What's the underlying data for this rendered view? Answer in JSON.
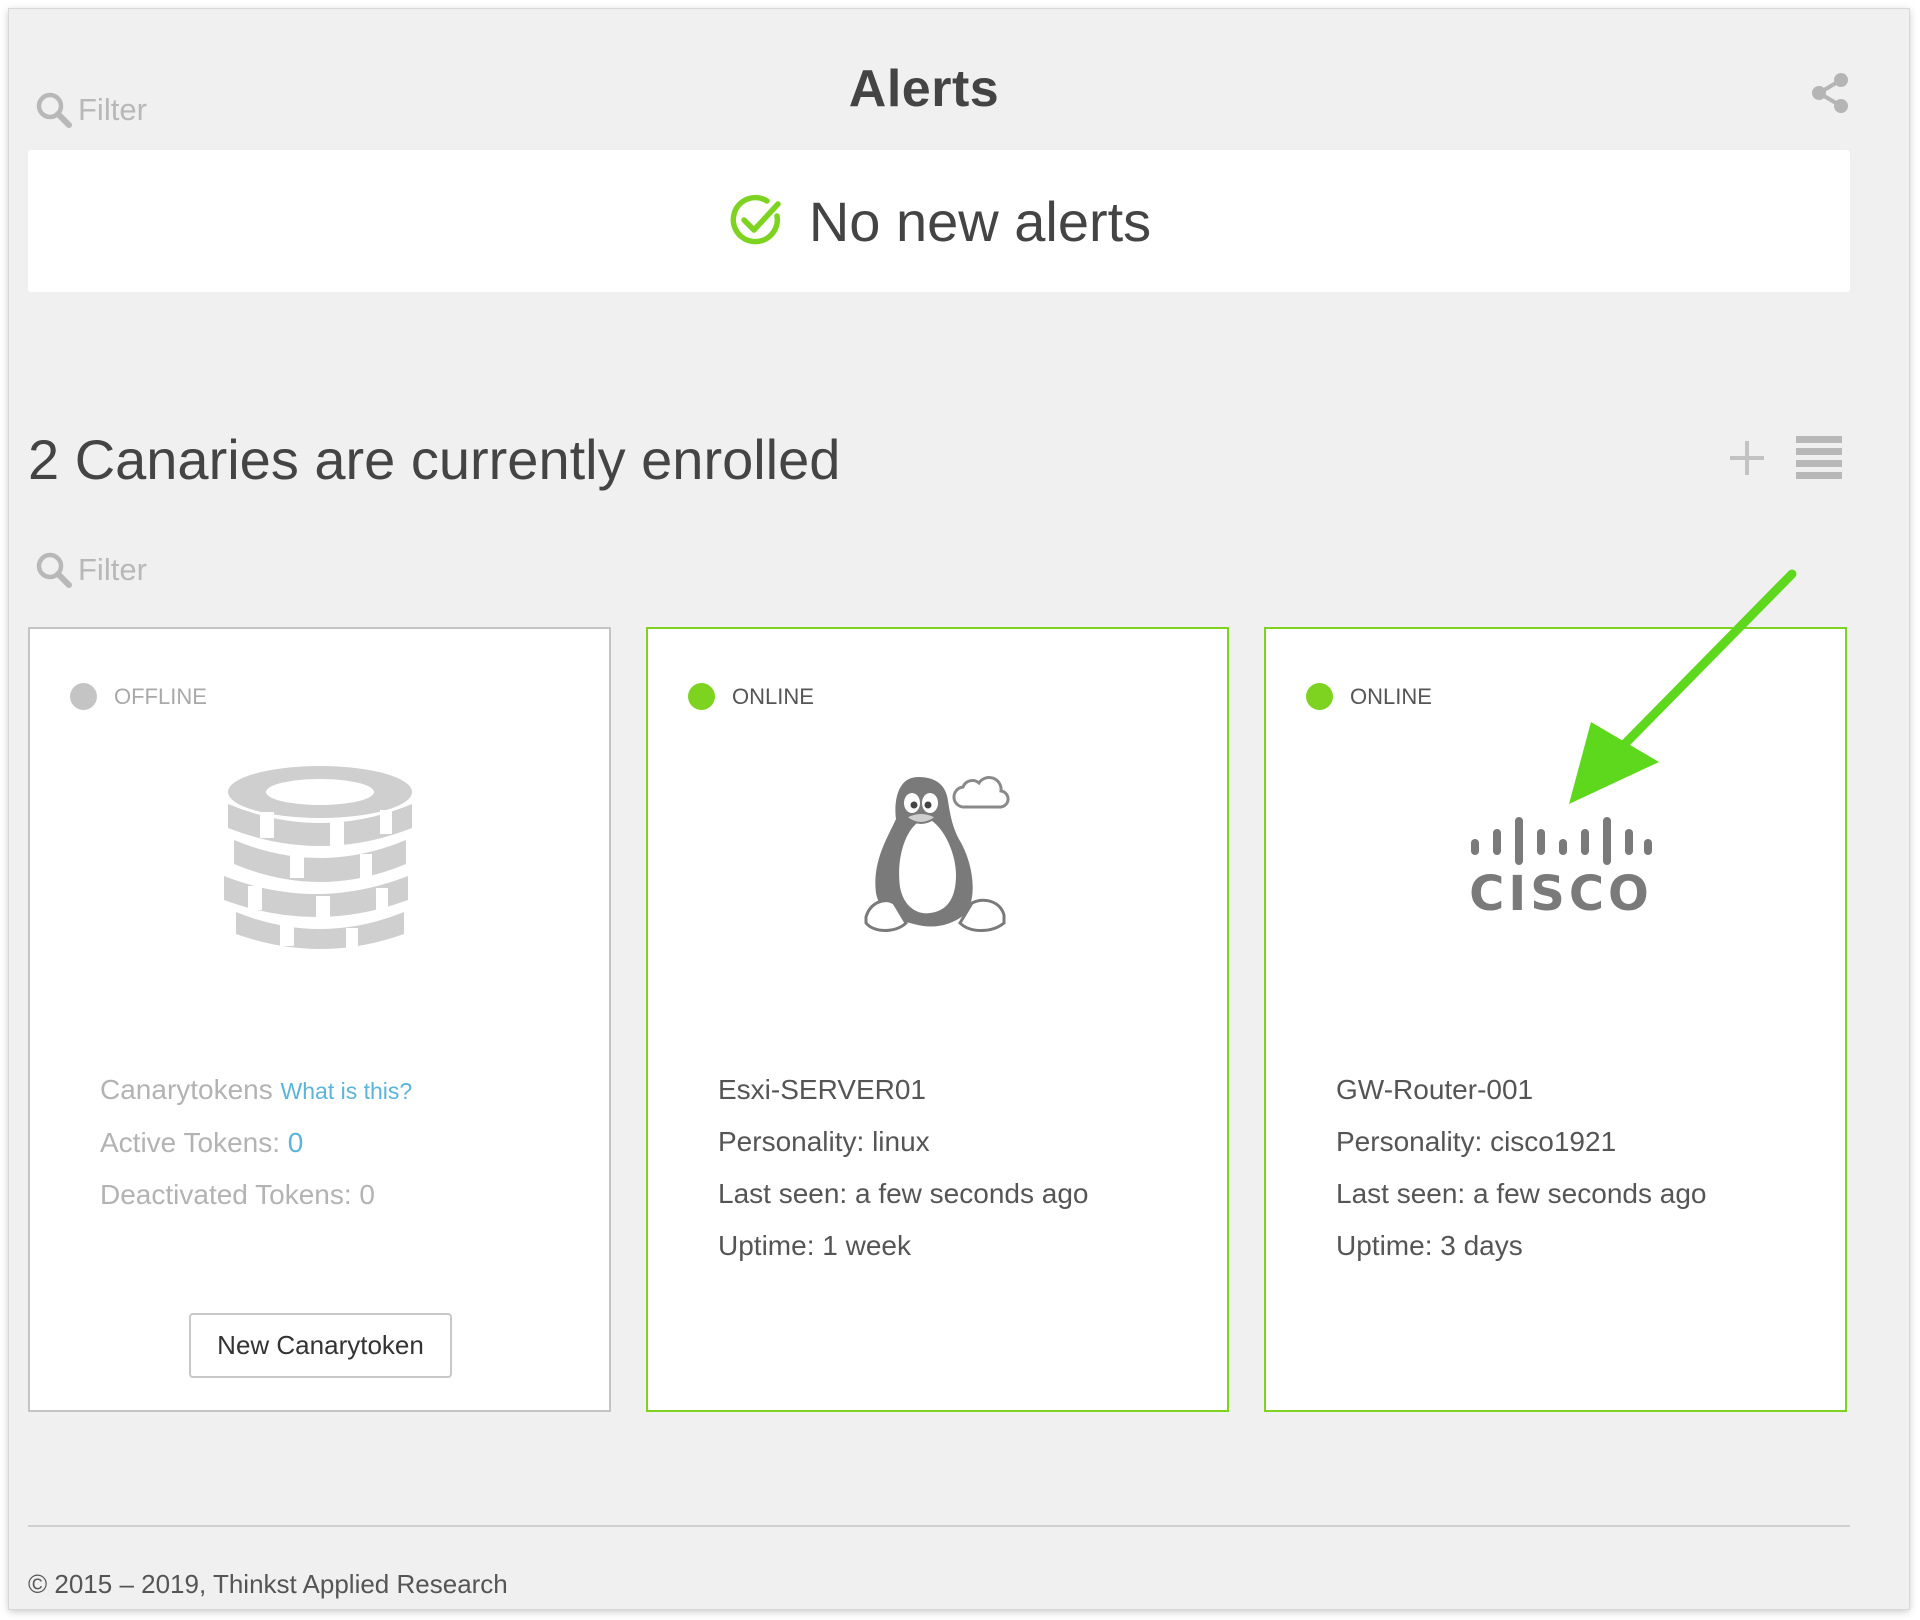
{
  "header": {
    "title": "Alerts",
    "filter_placeholder": "Filter"
  },
  "alerts": {
    "message": "No new alerts"
  },
  "devices": {
    "heading": "2 Canaries are currently enrolled",
    "filter_placeholder": "Filter"
  },
  "cards": {
    "tokens": {
      "status": "OFFLINE",
      "title": "Canarytokens",
      "help_link": "What is this?",
      "active_label": "Active Tokens: ",
      "active_count": "0",
      "deactivated_label": "Deactivated Tokens: 0",
      "button_label": "New Canarytoken"
    },
    "server": {
      "status": "ONLINE",
      "name": "Esxi-SERVER01",
      "personality": "Personality: linux",
      "last_seen": "Last seen: a few seconds ago",
      "uptime": "Uptime: 1 week"
    },
    "router": {
      "status": "ONLINE",
      "name": "GW-Router-001",
      "personality": "Personality: cisco1921",
      "last_seen": "Last seen: a few seconds ago",
      "uptime": "Uptime: 3 days",
      "logo_text": "CISCO"
    }
  },
  "footer": {
    "copyright": "© 2015 – 2019, Thinkst Applied Research"
  },
  "colors": {
    "online": "#7ed321",
    "offline": "#c4c4c4",
    "link": "#5bb5d9",
    "annotation_arrow": "#5ed81c"
  },
  "icons": [
    "search-icon",
    "share-icon",
    "check-circle-icon",
    "plus-icon",
    "list-view-icon",
    "token-stack-icon",
    "linux-penguin-icon",
    "cisco-logo-icon",
    "annotation-arrow-icon"
  ]
}
